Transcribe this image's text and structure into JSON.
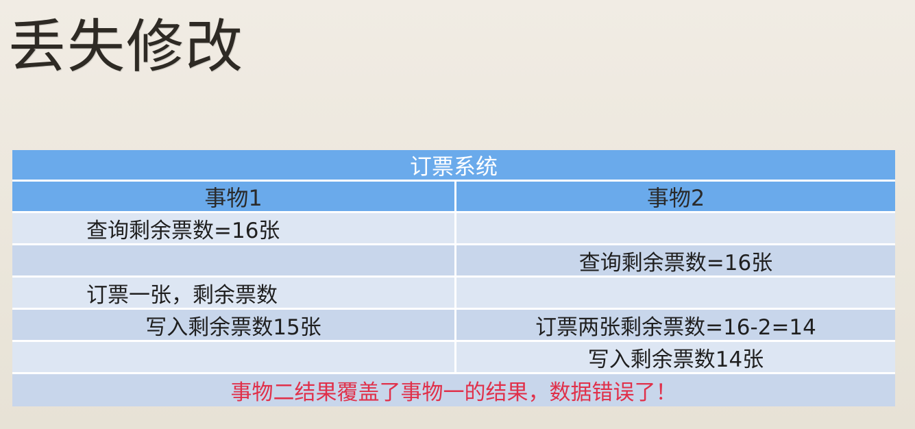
{
  "slide": {
    "title": "丢失修改"
  },
  "table": {
    "title": "订票系统",
    "columns": [
      "事物1",
      "事物2"
    ],
    "rows": [
      {
        "left": "查询剩余票数=16张",
        "right": ""
      },
      {
        "left": "",
        "right": "查询剩余票数=16张"
      },
      {
        "left": "订票一张，剩余票数",
        "right": ""
      },
      {
        "left": "写入剩余票数15张",
        "right": "订票两张剩余票数=16-2=14"
      },
      {
        "left": "",
        "right": "写入剩余票数14张"
      }
    ],
    "conclusion": "事物二结果覆盖了事物一的结果，数据错误了！"
  },
  "colors": {
    "header_blue": "#6aaaeb",
    "row_light": "#dde6f3",
    "row_dark": "#c8d6eb",
    "conclusion_red": "#e0304a"
  }
}
